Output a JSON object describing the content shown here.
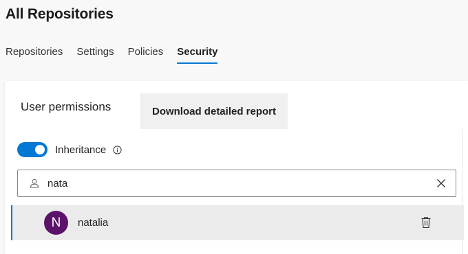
{
  "header": {
    "title": "All Repositories"
  },
  "tabs": [
    {
      "label": "Repositories",
      "active": false
    },
    {
      "label": "Settings",
      "active": false
    },
    {
      "label": "Policies",
      "active": false
    },
    {
      "label": "Security",
      "active": true
    }
  ],
  "permissions": {
    "title": "User permissions",
    "download_report_label": "Download detailed report",
    "inheritance": {
      "label": "Inheritance",
      "enabled": true,
      "info_icon": "info-icon"
    },
    "search": {
      "value": "nata",
      "user_icon": "person-icon",
      "clear_icon": "close-icon"
    },
    "users": [
      {
        "initial": "N",
        "name": "natalia",
        "avatar_color": "#5c126b",
        "delete_icon": "trash-icon"
      }
    ]
  },
  "colors": {
    "accent": "#0078d4",
    "avatar": "#5c126b"
  }
}
